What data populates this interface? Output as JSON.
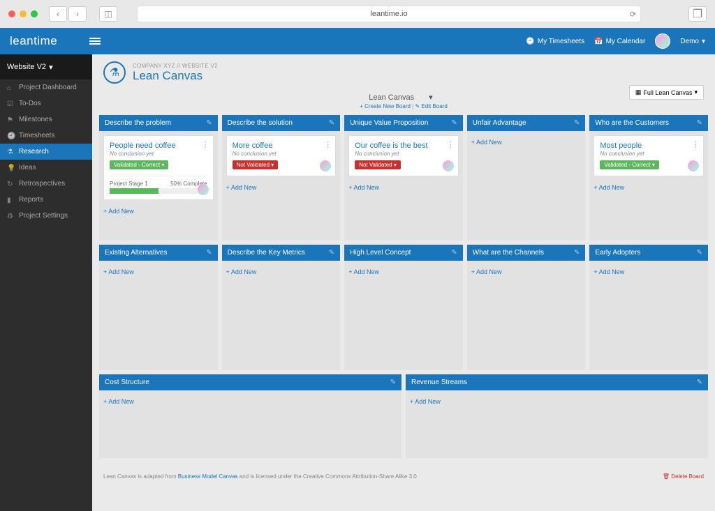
{
  "browser": {
    "url": "leantime.io"
  },
  "header": {
    "logo": "leantime",
    "timesheets": "My Timesheets",
    "calendar": "My Calendar",
    "user": "Demo"
  },
  "sidebar": {
    "project": "Website V2",
    "items": [
      {
        "label": "Project Dashboard",
        "icon": "home"
      },
      {
        "label": "To-Dos",
        "icon": "check"
      },
      {
        "label": "Milestones",
        "icon": "flag"
      },
      {
        "label": "Timesheets",
        "icon": "clock"
      },
      {
        "label": "Research",
        "icon": "flask",
        "active": true
      },
      {
        "label": "Ideas",
        "icon": "bulb"
      },
      {
        "label": "Retrospectives",
        "icon": "refresh"
      },
      {
        "label": "Reports",
        "icon": "chart"
      },
      {
        "label": "Project Settings",
        "icon": "gear"
      }
    ]
  },
  "page": {
    "breadcrumb": "COMPANY XYZ // WEBSITE V2",
    "title": "Lean Canvas",
    "board_name": "Lean Canvas",
    "create_board": "Create New Board",
    "edit_board": "Edit Board",
    "view_label": "Full Lean Canvas",
    "add_new": "Add New",
    "delete_board": "Delete Board",
    "footer_pre": "Lean Canvas is adapted from ",
    "footer_link": "Business Model Canvas",
    "footer_post": " and is licensed under the Creative Commons Attribution-Share Alike 3.0"
  },
  "columns": {
    "problem": {
      "title": "Describe the problem"
    },
    "solution": {
      "title": "Describe the solution"
    },
    "uvp": {
      "title": "Unique Value Proposition"
    },
    "advantage": {
      "title": "Unfair Advantage"
    },
    "customers": {
      "title": "Who are the Customers"
    },
    "alternatives": {
      "title": "Existing Alternatives"
    },
    "metrics": {
      "title": "Describe the Key Metrics"
    },
    "concept": {
      "title": "High Level Concept"
    },
    "channels": {
      "title": "What are the Channels"
    },
    "adopters": {
      "title": "Early Adopters"
    },
    "cost": {
      "title": "Cost Structure"
    },
    "revenue": {
      "title": "Revenue Streams"
    }
  },
  "cards": {
    "problem": {
      "title": "People need coffee",
      "sub": "No conclusion yet",
      "badge": "Validated - Correct",
      "badge_color": "green",
      "stage_label": "Project Stage 1",
      "stage_pct": "50% Complete",
      "progress": 50
    },
    "solution": {
      "title": "More coffee",
      "sub": "No conclusion yet",
      "badge": "Not Validated",
      "badge_color": "red"
    },
    "uvp": {
      "title": "Our coffee is the best",
      "sub": "No conclusion yet",
      "badge": "Not Validated",
      "badge_color": "red"
    },
    "customers": {
      "title": "Most people",
      "sub": "No conclusion yet",
      "badge": "Validated - Correct",
      "badge_color": "green"
    }
  }
}
